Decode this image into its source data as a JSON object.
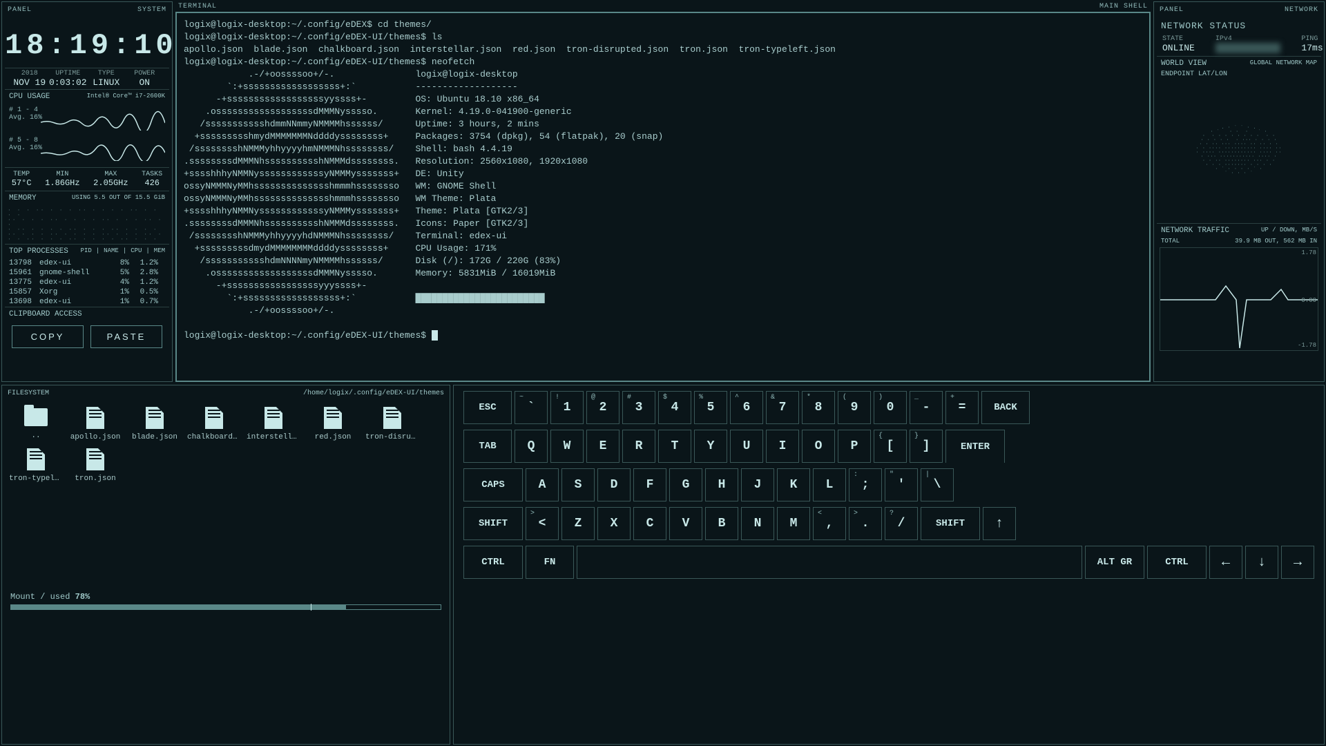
{
  "leftPanel": {
    "panelLabel": "PANEL",
    "systemLabel": "SYSTEM",
    "clock": "18:19:10",
    "sysinfo": {
      "year": "2018",
      "date": "NOV 19",
      "uptimeLabel": "UPTIME",
      "uptime": "0:03:02",
      "typeLabel": "TYPE",
      "type": "LINUX",
      "powerLabel": "POWER",
      "power": "ON"
    },
    "cpu": {
      "title": "CPU USAGE",
      "model": "Intel® Core™ i7-2600K",
      "g1label": "# 1 - 4",
      "g1avg": "Avg. 16%",
      "g2label": "# 5 - 8",
      "g2avg": "Avg. 16%"
    },
    "temps": {
      "tempL": "TEMP",
      "temp": "57°C",
      "minL": "MIN",
      "min": "1.86GHz",
      "maxL": "MAX",
      "max": "2.05GHz",
      "tasksL": "TASKS",
      "tasks": "426"
    },
    "memory": {
      "title": "MEMORY",
      "usage": "USING 5.5 OUT OF 15.5 GiB"
    },
    "processes": {
      "title": "TOP PROCESSES",
      "hPid": "PID",
      "hName": "NAME",
      "hCpu": "CPU",
      "hMem": "MEM",
      "rows": [
        {
          "pid": "13798",
          "name": "edex-ui",
          "cpu": "8%",
          "mem": "1.2%"
        },
        {
          "pid": "15961",
          "name": "gnome-shell",
          "cpu": "5%",
          "mem": "2.8%"
        },
        {
          "pid": "13775",
          "name": "edex-ui",
          "cpu": "4%",
          "mem": "1.2%"
        },
        {
          "pid": "15857",
          "name": "Xorg",
          "cpu": "1%",
          "mem": "0.5%"
        },
        {
          "pid": "13698",
          "name": "edex-ui",
          "cpu": "1%",
          "mem": "0.7%"
        }
      ]
    },
    "clipboard": {
      "title": "CLIPBOARD ACCESS",
      "copy": "COPY",
      "paste": "PASTE"
    }
  },
  "terminal": {
    "label": "TERMINAL",
    "mainshell": "MAIN SHELL",
    "lines": [
      "logix@logix-desktop:~/.config/eDEX$ cd themes/",
      "logix@logix-desktop:~/.config/eDEX-UI/themes$ ls",
      "apollo.json  blade.json  chalkboard.json  interstellar.json  red.json  tron-disrupted.json  tron.json  tron-typeleft.json",
      "logix@logix-desktop:~/.config/eDEX-UI/themes$ neofetch",
      "            .-/+oossssoo+/-.               logix@logix-desktop",
      "        `:+ssssssssssssssssss+:`           -------------------",
      "      -+ssssssssssssssssssyyssss+-         OS: Ubuntu 18.10 x86_64",
      "    .ossssssssssssssssssdMMMNysssso.       Kernel: 4.19.0-041900-generic",
      "   /ssssssssssshdmmNNmmyNMMMMhssssss/      Uptime: 3 hours, 2 mins",
      "  +ssssssssshmydMMMMMMMNddddyssssssss+     Packages: 3754 (dpkg), 54 (flatpak), 20 (snap)",
      " /sssssssshNMMMyhhyyyyhmNMMMNhssssssss/    Shell: bash 4.4.19",
      ".ssssssssdMMMNhsssssssssshNMMMdssssssss.   Resolution: 2560x1080, 1920x1080",
      "+sssshhhyNMMNyssssssssssssyNMMMysssssss+   DE: Unity",
      "ossyNMMMNyMMhsssssssssssssshmmmhssssssso   WM: GNOME Shell",
      "ossyNMMMNyMMhsssssssssssssshmmmhssssssso   WM Theme: Plata",
      "+sssshhhyNMMNyssssssssssssyNMMMysssssss+   Theme: Plata [GTK2/3]",
      ".ssssssssdMMMNhsssssssssshNMMMdssssssss.   Icons: Paper [GTK2/3]",
      " /sssssssshNMMMyhhyyyyhdNMMMNhssssssss/    Terminal: edex-ui",
      "  +sssssssssdmydMMMMMMMMddddyssssssss+     CPU Usage: 171%",
      "   /ssssssssssshdmNNNNmyNMMMMhssssss/      Disk (/): 172G / 220G (83%)",
      "    .ossssssssssssssssssdMMMNysssso.       Memory: 5831MiB / 16019MiB",
      "      -+sssssssssssssssssyyyssss+-",
      "        `:+ssssssssssssssssss+:`           ████████████████████████",
      "            .-/+oossssoo+/-.",
      "",
      "logix@logix-desktop:~/.config/eDEX-UI/themes$ "
    ]
  },
  "rightPanel": {
    "panelLabel": "PANEL",
    "networkLabel": "NETWORK",
    "status": {
      "title": "NETWORK STATUS",
      "stateL": "STATE",
      "state": "ONLINE",
      "ipvL": "IPv4",
      "ipv": "",
      "pingL": "PING",
      "ping": "17ms"
    },
    "world": {
      "title": "WORLD VIEW",
      "sub": "GLOBAL NETWORK MAP",
      "endpoint": "ENDPOINT LAT/LON"
    },
    "traffic": {
      "title": "NETWORK TRAFFIC",
      "sub": "UP / DOWN, MB/S",
      "totalL": "TOTAL",
      "total": "39.9 MB OUT, 562 MB IN",
      "yTop": "1.78",
      "yMid": "0.00",
      "yBot": "-1.78"
    }
  },
  "filesystem": {
    "title": "FILESYSTEM",
    "path": "/home/logix/.config/eDEX-UI/themes",
    "items": [
      {
        "name": "..",
        "type": "folder"
      },
      {
        "name": "apollo.json",
        "type": "file"
      },
      {
        "name": "blade.json",
        "type": "file"
      },
      {
        "name": "chalkboard.json",
        "type": "file"
      },
      {
        "name": "interstellar.js...",
        "type": "file"
      },
      {
        "name": "red.json",
        "type": "file"
      },
      {
        "name": "tron-disrupte...",
        "type": "file"
      },
      {
        "name": "tron-typeleft....",
        "type": "file"
      },
      {
        "name": "tron.json",
        "type": "file"
      }
    ],
    "mountLabel": "Mount / used",
    "mountPct": "78%"
  },
  "keyboard": {
    "row1": [
      {
        "main": "ESC",
        "wide": true
      },
      {
        "main": "`",
        "sup": "~"
      },
      {
        "main": "1",
        "sup": "!"
      },
      {
        "main": "2",
        "sup": "@"
      },
      {
        "main": "3",
        "sup": "#"
      },
      {
        "main": "4",
        "sup": "$"
      },
      {
        "main": "5",
        "sup": "%"
      },
      {
        "main": "6",
        "sup": "^"
      },
      {
        "main": "7",
        "sup": "&"
      },
      {
        "main": "8",
        "sup": "*"
      },
      {
        "main": "9",
        "sup": "("
      },
      {
        "main": "0",
        "sup": ")"
      },
      {
        "main": "-",
        "sup": "_"
      },
      {
        "main": "=",
        "sup": "+"
      },
      {
        "main": "BACK",
        "wide": true
      }
    ],
    "row2": [
      {
        "main": "TAB",
        "wide": true
      },
      {
        "main": "Q"
      },
      {
        "main": "W"
      },
      {
        "main": "E"
      },
      {
        "main": "R"
      },
      {
        "main": "T"
      },
      {
        "main": "Y"
      },
      {
        "main": "U"
      },
      {
        "main": "I"
      },
      {
        "main": "O"
      },
      {
        "main": "P"
      },
      {
        "main": "[",
        "sup": "{"
      },
      {
        "main": "]",
        "sup": "}"
      },
      {
        "main": "ENTER",
        "enter": true
      }
    ],
    "row3": [
      {
        "main": "CAPS",
        "wider": true
      },
      {
        "main": "A"
      },
      {
        "main": "S"
      },
      {
        "main": "D"
      },
      {
        "main": "F"
      },
      {
        "main": "G"
      },
      {
        "main": "H"
      },
      {
        "main": "J"
      },
      {
        "main": "K"
      },
      {
        "main": "L"
      },
      {
        "main": ";",
        "sup": ":"
      },
      {
        "main": "'",
        "sup": "\""
      },
      {
        "main": "\\",
        "sup": "|"
      }
    ],
    "row4": [
      {
        "main": "SHIFT",
        "wider": true
      },
      {
        "main": "<",
        "sup": ">"
      },
      {
        "main": "Z"
      },
      {
        "main": "X"
      },
      {
        "main": "C"
      },
      {
        "main": "V"
      },
      {
        "main": "B"
      },
      {
        "main": "N"
      },
      {
        "main": "M"
      },
      {
        "main": ",",
        "sup": "<"
      },
      {
        "main": ".",
        "sup": ">"
      },
      {
        "main": "/",
        "sup": "?"
      },
      {
        "main": "SHIFT",
        "wider": true
      },
      {
        "main": "↑",
        "arrow": true
      }
    ],
    "row5": [
      {
        "main": "CTRL",
        "wider": true
      },
      {
        "main": "FN",
        "wide": true
      },
      {
        "main": "",
        "space": true
      },
      {
        "main": "ALT GR",
        "wider": true
      },
      {
        "main": "CTRL",
        "wider": true
      },
      {
        "main": "←",
        "arrow": true
      },
      {
        "main": "↓",
        "arrow": true
      },
      {
        "main": "→",
        "arrow": true
      }
    ]
  }
}
